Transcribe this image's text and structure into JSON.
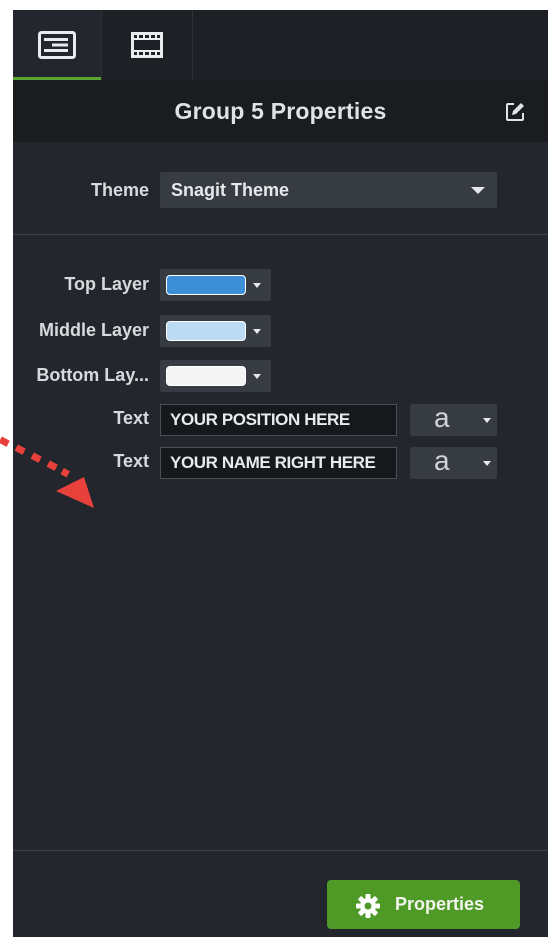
{
  "header": {
    "title": "Group 5 Properties"
  },
  "tabs": [
    {
      "icon": "properties-panel-icon",
      "active": true
    },
    {
      "icon": "film-strip-icon",
      "active": false
    }
  ],
  "theme": {
    "label": "Theme",
    "value": "Snagit Theme"
  },
  "layers": [
    {
      "label": "Top Layer",
      "color": "#3d8fd8"
    },
    {
      "label": "Middle Layer",
      "color": "#bcdcf6"
    },
    {
      "label": "Bottom Lay...",
      "color": "#f4f4f4"
    }
  ],
  "text_fields": [
    {
      "label": "Text",
      "value": "YOUR POSITION HERE",
      "font_glyph": "a"
    },
    {
      "label": "Text",
      "value": "YOUR NAME RIGHT HERE",
      "font_glyph": "a"
    }
  ],
  "footer": {
    "properties_label": "Properties"
  },
  "colors": {
    "accent": "#4f9a26",
    "panel": "#23262c",
    "annotation_arrow": "#e8413c"
  }
}
